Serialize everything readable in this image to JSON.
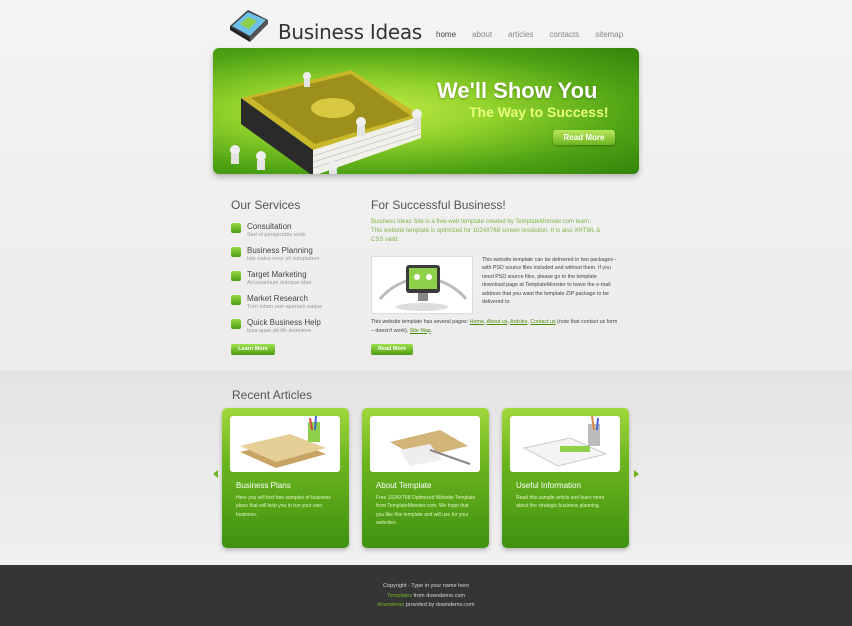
{
  "header": {
    "site_title": "Business Ideas",
    "nav": [
      {
        "label": "home",
        "active": true
      },
      {
        "label": "about"
      },
      {
        "label": "articles"
      },
      {
        "label": "contacts"
      },
      {
        "label": "sitemap"
      }
    ]
  },
  "banner": {
    "headline": "We'll Show You",
    "subheadline": "The Way to Success!",
    "button": "Read More"
  },
  "services": {
    "title": "Our Services",
    "items": [
      {
        "name": "Consultation",
        "desc": "Sed ut perspiciatis unde"
      },
      {
        "name": "Business Planning",
        "desc": "Iste natus error sit voluptatem"
      },
      {
        "name": "Target Marketing",
        "desc": "Accusantium doloque idan"
      },
      {
        "name": "Market Research",
        "desc": "Tum totam rem aperiam eaque"
      },
      {
        "name": "Quick Business Help",
        "desc": "Ipsa quae ab illo inventore"
      }
    ],
    "button": "Learn More"
  },
  "business": {
    "title": "For Successful Business!",
    "intro": "Business Ideas Site is a free web template created by TemplateMonster.com team. This website template is optimized for 1024X768 screen resolution. It is also XHTML & CSS valid.",
    "body": "This website template can be delivered in two packages - with PSD source files included and without them. If you need PSD source files, please go to the template download page at TemplateMonster to leave the e-mail address that you want the template ZIP package to be delivered to.",
    "pages_pre": "This website template has several pages:",
    "pages_links": [
      "Home",
      "About us",
      "Articles",
      "Contact us"
    ],
    "pages_mid": "(note that contact us form – doesn't work),",
    "pages_last": "Site Map",
    "button": "Read More"
  },
  "articles": {
    "title": "Recent Articles",
    "cards": [
      {
        "title": "Business Plans",
        "text": "Here you will find free samples of business plans that will help you to run your own business."
      },
      {
        "title": "About Template",
        "text": "Free 1024X768 Optimized Website Template from TemplateMonster.com. We hope that you like this template and will use for your websites."
      },
      {
        "title": "Useful Information",
        "text": "Read this sample article and learn more about the strategic business planning."
      }
    ]
  },
  "footer": {
    "line1": "Copyright - Type in your name here",
    "line2_link": "Templates",
    "line2_text": "from downdemo.com",
    "line3_link": "downdemo",
    "line3_text": "provided by downdemo.com"
  },
  "colors": {
    "accent": "#6fb420",
    "footer_bg": "#353535"
  }
}
